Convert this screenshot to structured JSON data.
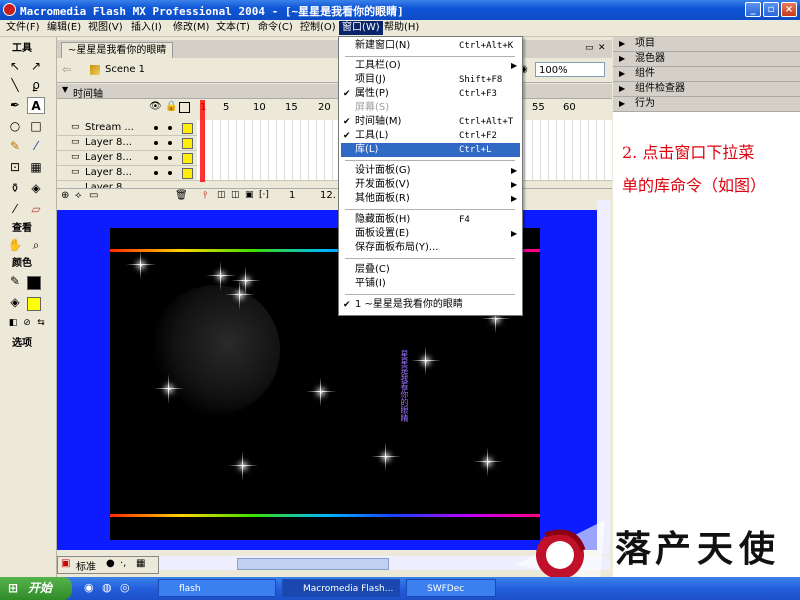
{
  "window": {
    "title": "Macromedia Flash MX Professional 2004 - [~星星是我看你的眼睛]"
  },
  "menubar": [
    {
      "label": "文件(F)"
    },
    {
      "label": "编辑(E)"
    },
    {
      "label": "视图(V)"
    },
    {
      "label": "插入(I)"
    },
    {
      "label": "修改(M)"
    },
    {
      "label": "文本(T)"
    },
    {
      "label": "命令(C)"
    },
    {
      "label": "控制(O)"
    },
    {
      "label": "窗口(W)"
    },
    {
      "label": "帮助(H)"
    }
  ],
  "toolbox": {
    "title": "工具",
    "view_label": "查看",
    "colors_label": "颜色",
    "options_label": "选项"
  },
  "document": {
    "tab_label": "~星星是我看你的眼睛",
    "scene_label": "Scene 1",
    "zoom": "100%"
  },
  "timeline": {
    "title": "时间轴",
    "frame_numbers": [
      "1",
      "5",
      "10",
      "15",
      "20",
      "25",
      "55",
      "60"
    ],
    "layers": [
      {
        "name": "Stream ..."
      },
      {
        "name": "Layer 8..."
      },
      {
        "name": "Layer 8..."
      },
      {
        "name": "Layer 8..."
      },
      {
        "name": "Layer 8..."
      }
    ],
    "current_frame": "1",
    "fps": "12."
  },
  "stage": {
    "vertical_text": "星星是我看你的眼睛"
  },
  "window_menu": {
    "items": [
      {
        "label": "新建窗口(N)",
        "shortcut": "Ctrl+Alt+K"
      },
      {
        "label": "工具栏(O)",
        "submenu": true
      },
      {
        "label": "项目(J)",
        "shortcut": "Shift+F8"
      },
      {
        "label": "属性(P)",
        "shortcut": "Ctrl+F3",
        "checked": true
      },
      {
        "label": "屏幕(S)",
        "disabled": true
      },
      {
        "label": "时间轴(M)",
        "shortcut": "Ctrl+Alt+T",
        "checked": true
      },
      {
        "label": "工具(L)",
        "shortcut": "Ctrl+F2",
        "checked": true
      },
      {
        "label": "库(L)",
        "shortcut": "Ctrl+L",
        "highlighted": true
      },
      {
        "label": "设计面板(G)",
        "submenu": true
      },
      {
        "label": "开发面板(V)",
        "submenu": true
      },
      {
        "label": "其他面板(R)",
        "submenu": true
      },
      {
        "label": "隐藏面板(H)",
        "shortcut": "F4"
      },
      {
        "label": "面板设置(E)",
        "submenu": true
      },
      {
        "label": "保存面板布局(Y)..."
      },
      {
        "label": "层叠(C)"
      },
      {
        "label": "平铺(I)"
      },
      {
        "label": "1 ~星星是我看你的眼睛",
        "checked": true
      }
    ]
  },
  "right_panels": [
    {
      "label": "项目"
    },
    {
      "label": "混色器"
    },
    {
      "label": "组件"
    },
    {
      "label": "组件检查器"
    },
    {
      "label": "行为"
    }
  ],
  "annotation": {
    "line1": "2. 点击窗口下拉菜",
    "line2": "单的库命令（如图）"
  },
  "bottom_bar": {
    "mode": "标准"
  },
  "taskbar": {
    "start_label": "开始",
    "tasks": [
      {
        "label": "flash"
      },
      {
        "label": "Macromedia Flash..."
      },
      {
        "label": "SWFDec"
      }
    ]
  },
  "colors": {
    "titlebar": "#0f56d8",
    "stage_bg": "#0c1cff",
    "menu_highlight": "#316ac5",
    "annotation": "#e0000d"
  }
}
